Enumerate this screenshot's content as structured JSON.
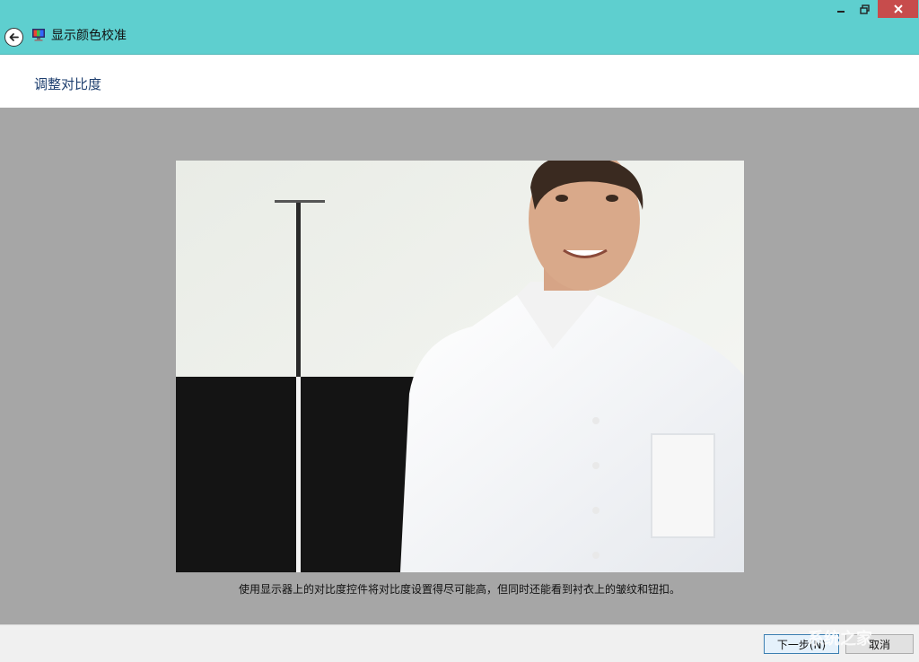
{
  "window": {
    "title": "显示颜色校准"
  },
  "header": {
    "title": "调整对比度"
  },
  "main": {
    "caption": "使用显示器上的对比度控件将对比度设置得尽可能高，但同时还能看到衬衣上的皱纹和钮扣。"
  },
  "footer": {
    "next_label": "下一步(N)",
    "cancel_label": "取消"
  },
  "watermark": {
    "text": "系统之家"
  },
  "icons": [
    "back-arrow-icon",
    "display-calibration-icon",
    "minimize-icon",
    "restore-icon",
    "close-icon"
  ],
  "colors": {
    "titlebar": "#5ecfcf",
    "close_button": "#c74c4c",
    "title_text": "#1e3f6f",
    "background": "#a6a6a6"
  }
}
